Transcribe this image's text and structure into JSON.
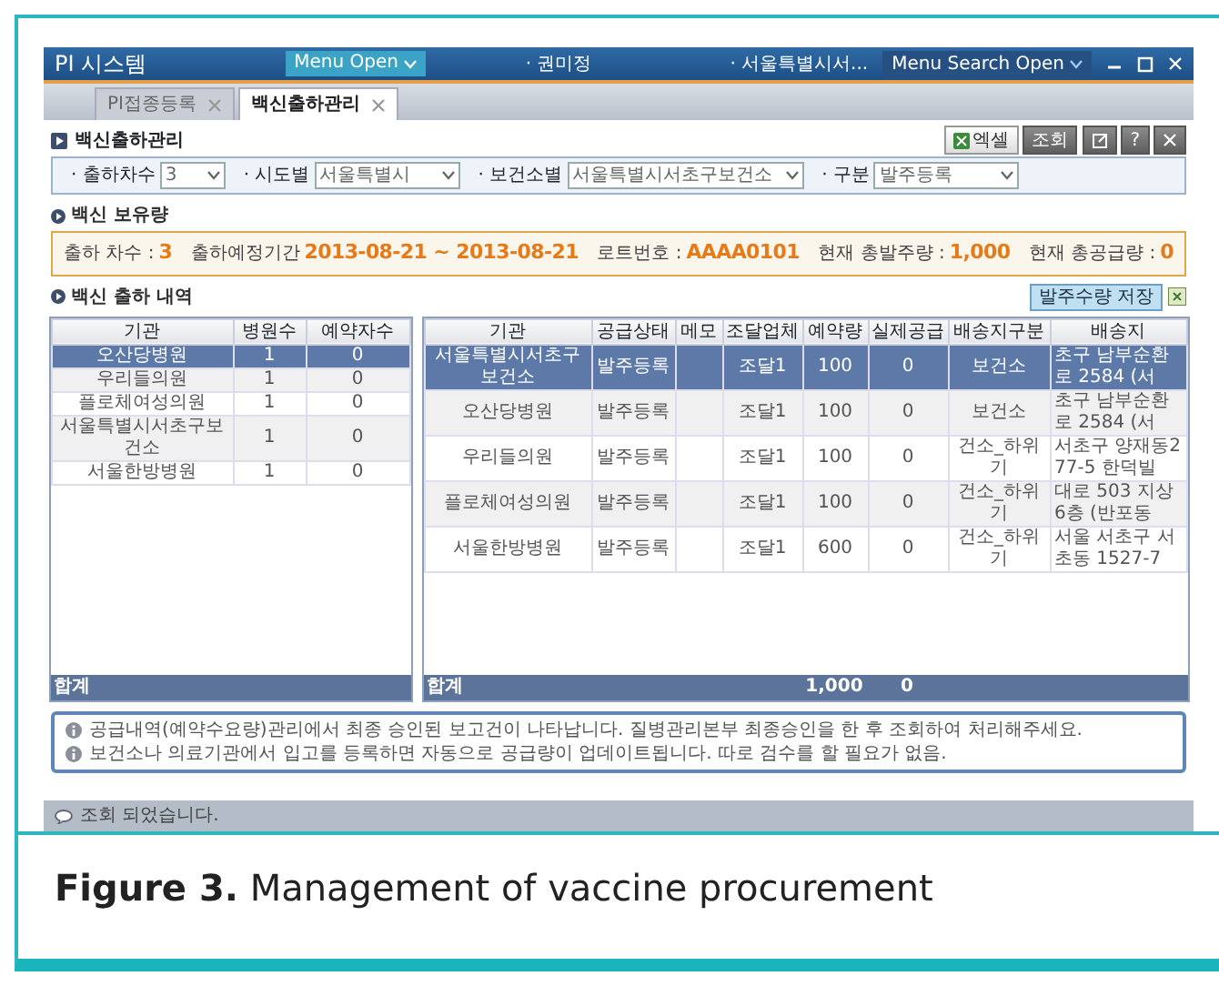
{
  "app": {
    "title": "PI 시스템",
    "menu_button": "Menu Open",
    "user": "· 권미정",
    "org": "· 서울특별시서...",
    "search_button": "Menu Search Open"
  },
  "tabs": [
    {
      "label": "PI접종등록",
      "selected": false
    },
    {
      "label": "백신출하관리",
      "selected": true
    }
  ],
  "page": {
    "title": "백신출하관리",
    "toolbar": [
      {
        "kind": "excel",
        "label": "엑셀"
      },
      {
        "kind": "text",
        "label": "조회"
      },
      {
        "kind": "popup"
      },
      {
        "kind": "text",
        "label": "?"
      },
      {
        "kind": "close"
      }
    ]
  },
  "filters": [
    {
      "label": "· 출하차수",
      "value": "3"
    },
    {
      "label": "· 시도별",
      "value": "서울특별시"
    },
    {
      "label": "· 보건소별",
      "value": "서울특별시서초구보건소"
    },
    {
      "label": "· 구분",
      "value": "발주등록"
    }
  ],
  "stock": {
    "title": "백신 보유량",
    "items": [
      {
        "label": "출하 차수 :",
        "value": "3"
      },
      {
        "label": "출하예정기간",
        "value": "2013-08-21 ~ 2013-08-21"
      },
      {
        "label": "로트번호 :",
        "value": "AAAA0101"
      },
      {
        "label": "현재 총발주량 :",
        "value": "1,000"
      },
      {
        "label": "현재 총공급량 :",
        "value": "0"
      }
    ]
  },
  "history": {
    "title": "백신 출하 내역",
    "save_button": "발주수량 저장"
  },
  "left_table": {
    "columns": [
      "기관",
      "병원수",
      "예약자수"
    ],
    "rows": [
      {
        "institution": "오산당병원",
        "hospitals": "1",
        "reservations": "0",
        "selected": true
      },
      {
        "institution": "우리들의원",
        "hospitals": "1",
        "reservations": "0",
        "selected": false
      },
      {
        "institution": "플로체여성의원",
        "hospitals": "1",
        "reservations": "0",
        "selected": false
      },
      {
        "institution": "서울특별시서초구보건소",
        "hospitals": "1",
        "reservations": "0",
        "selected": false
      },
      {
        "institution": "서울한방병원",
        "hospitals": "1",
        "reservations": "0",
        "selected": false
      }
    ],
    "footer": {
      "label": "합계"
    }
  },
  "right_table": {
    "columns": [
      "기관",
      "공급상태",
      "메모",
      "조달업체",
      "예약량",
      "실제공급",
      "배송지구분",
      "배송지"
    ],
    "rows": [
      {
        "institution": "서울특별시서초구보건소",
        "status": "발주등록",
        "supplier": "조달1",
        "reserved": "100",
        "supplied": "0",
        "delivery_type": "보건소",
        "address": "초구 남부순환로 2584 (서",
        "selected": true
      },
      {
        "institution": "오산당병원",
        "status": "발주등록",
        "supplier": "조달1",
        "reserved": "100",
        "supplied": "0",
        "delivery_type": "보건소",
        "address": "초구 남부순환로 2584 (서",
        "selected": false
      },
      {
        "institution": "우리들의원",
        "status": "발주등록",
        "supplier": "조달1",
        "reserved": "100",
        "supplied": "0",
        "delivery_type": "건소_하위기",
        "address": "서초구 양재동277-5 한덕빌",
        "selected": false
      },
      {
        "institution": "플로체여성의원",
        "status": "발주등록",
        "supplier": "조달1",
        "reserved": "100",
        "supplied": "0",
        "delivery_type": "건소_하위기",
        "address": "대로 503 지상 6층 (반포동",
        "selected": false
      },
      {
        "institution": "서울한방병원",
        "status": "발주등록",
        "supplier": "조달1",
        "reserved": "600",
        "supplied": "0",
        "delivery_type": "건소_하위기",
        "address": "서울 서초구 서초동 1527-7",
        "selected": false
      }
    ],
    "footer": {
      "label": "합계",
      "reserved": "1,000",
      "supplied": "0"
    }
  },
  "notes": [
    "공급내역(예약수요량)관리에서 최종 승인된 보고건이 나타납니다. 질병관리본부 최종승인을 한 후 조회하여 처리해주세요.",
    "보건소나 의료기관에서 입고를 등록하면 자동으로 공급량이 업데이트됩니다. 따로 검수를 할 필요가 없음."
  ],
  "status_bar": "조회 되었습니다.",
  "figure": {
    "caption": "**Figure 3.** Management of vaccine procurement"
  }
}
